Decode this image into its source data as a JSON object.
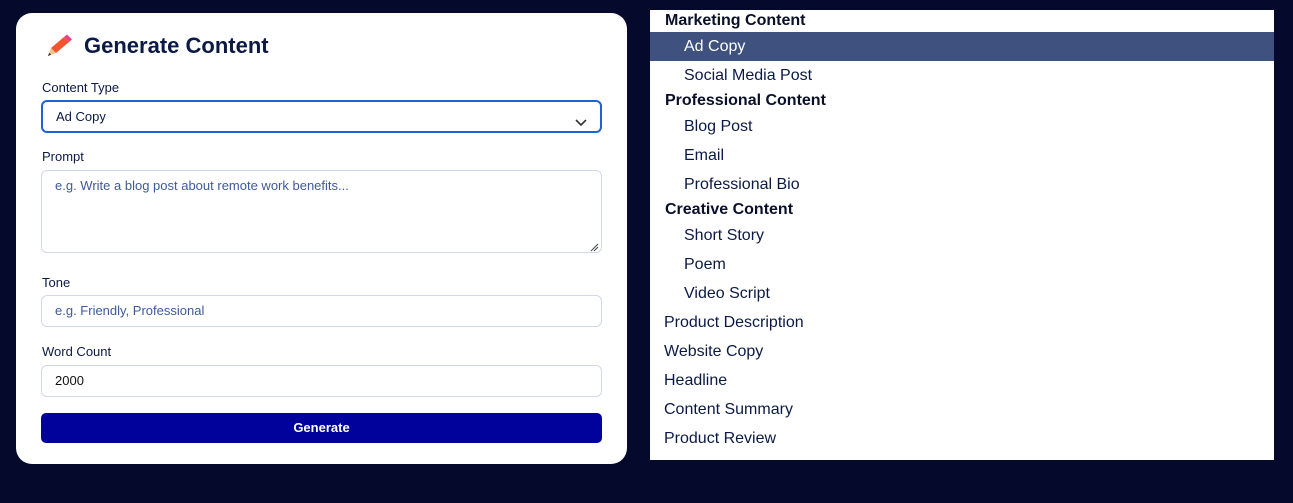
{
  "form": {
    "title": "Generate Content",
    "content_type_label": "Content Type",
    "content_type_value": "Ad Copy",
    "prompt_label": "Prompt",
    "prompt_placeholder": "e.g. Write a blog post about remote work benefits...",
    "tone_label": "Tone",
    "tone_placeholder": "e.g. Friendly, Professional",
    "word_count_label": "Word Count",
    "word_count_value": "2000",
    "generate_label": "Generate"
  },
  "dropdown": {
    "groups": [
      {
        "label": "Marketing Content",
        "options": [
          "Ad Copy",
          "Social Media Post"
        ]
      },
      {
        "label": "Professional Content",
        "options": [
          "Blog Post",
          "Email",
          "Professional Bio"
        ]
      },
      {
        "label": "Creative Content",
        "options": [
          "Short Story",
          "Poem",
          "Video Script"
        ]
      }
    ],
    "top_level_options": [
      "Product Description",
      "Website Copy",
      "Headline",
      "Content Summary",
      "Product Review"
    ],
    "selected": "Ad Copy"
  },
  "colors": {
    "background": "#050a2c",
    "accent": "#1c63d8",
    "button": "#01019b",
    "selected_option": "#3e517f"
  }
}
